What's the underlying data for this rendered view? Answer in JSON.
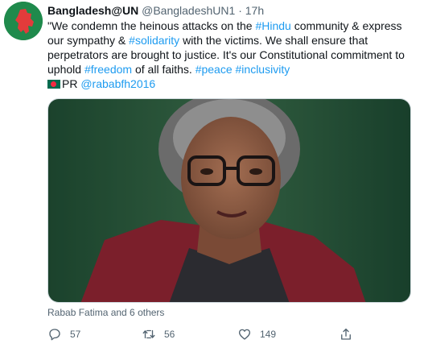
{
  "tweet": {
    "author_name": "Bangladesh@UN",
    "author_handle": "@BangladeshUN1",
    "separator": "·",
    "time": "17h",
    "text": {
      "p1": "\"We condemn the heinous attacks on the ",
      "tag_hindu": "#Hindu",
      "p2": " community & express our sympathy & ",
      "tag_solidarity": "#solidarity",
      "p3": " with the victims. We shall ensure that perpetrators are brought to justice. It's our Constitutional commitment to uphold ",
      "tag_freedom": "#freedom",
      "p4": " of all faiths.    ",
      "tag_peace": "#peace",
      "tag_inclusivity": "#inclusivity",
      "pr_label": "PR ",
      "mention": "@rababfh2016"
    },
    "tagged_people": "Rabab Fatima and 6 others",
    "actions": {
      "reply": {
        "icon": "reply-icon",
        "count": "57"
      },
      "retweet": {
        "icon": "retweet-icon",
        "count": "56"
      },
      "like": {
        "icon": "heart-icon",
        "count": "149"
      },
      "share": {
        "icon": "share-icon"
      }
    }
  },
  "colors": {
    "link": "#1d9bf0",
    "secondary_text": "#536471",
    "avatar_green": "#1f8a4c",
    "flag_green": "#006a4e",
    "flag_red": "#f42a41"
  }
}
